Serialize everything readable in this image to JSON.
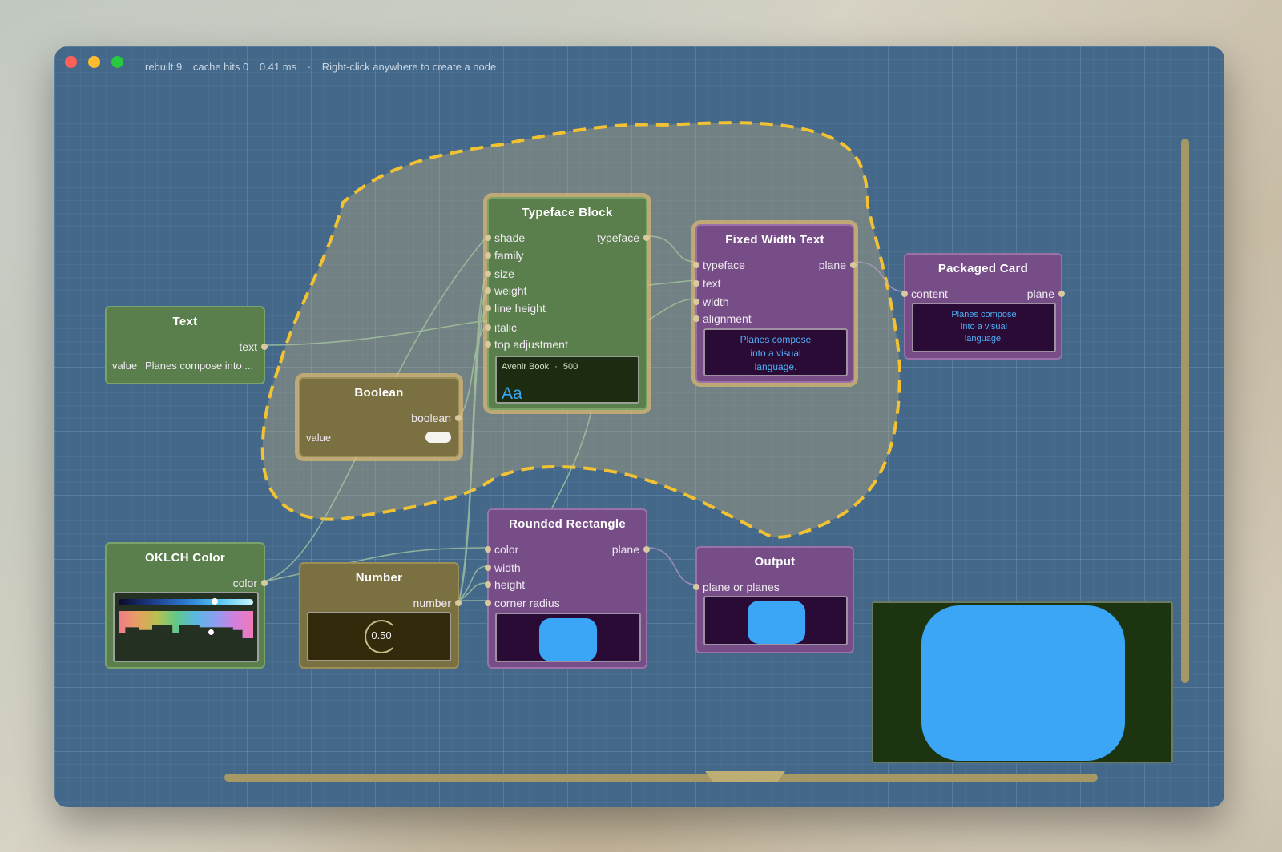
{
  "status": {
    "rebuilt": "rebuilt 9",
    "cache_hits": "cache hits 0",
    "time": "0.41 ms",
    "separator": "·",
    "hint": "Right-click anywhere to create a node"
  },
  "colors": {
    "canvas": "#44688a",
    "selection": "#f2c232",
    "green_node": "#5a7f4c",
    "purple_node": "#764d86",
    "olive_node": "#7b7041",
    "preview_blue": "#3aa6f5"
  },
  "nodes": {
    "text": {
      "title": "Text",
      "out": "text",
      "value_label": "value",
      "value": "Planes compose into ..."
    },
    "boolean": {
      "title": "Boolean",
      "out": "boolean",
      "value_label": "value",
      "value_on": true
    },
    "typeface": {
      "title": "Typeface Block",
      "inputs": [
        "shade",
        "family",
        "size",
        "weight",
        "line height",
        "italic",
        "top adjustment"
      ],
      "out": "typeface",
      "preview_font": "Avenir Book",
      "preview_sep": "·",
      "preview_weight": "500",
      "preview_sample": "Aa"
    },
    "fixed_width": {
      "title": "Fixed Width Text",
      "inputs": [
        "typeface",
        "text",
        "width",
        "alignment"
      ],
      "out": "plane",
      "preview_lines": [
        "Planes compose",
        "into a visual",
        "language."
      ]
    },
    "packaged": {
      "title": "Packaged Card",
      "input": "content",
      "out": "plane",
      "preview_lines": [
        "Planes compose",
        "into a visual",
        "language."
      ]
    },
    "oklch": {
      "title": "OKLCH Color",
      "out": "color"
    },
    "number": {
      "title": "Number",
      "out": "number",
      "value": "0.50"
    },
    "rounded_rect": {
      "title": "Rounded Rectangle",
      "inputs": [
        "color",
        "width",
        "height",
        "corner radius"
      ],
      "out": "plane"
    },
    "output": {
      "title": "Output",
      "input": "plane or planes"
    }
  }
}
